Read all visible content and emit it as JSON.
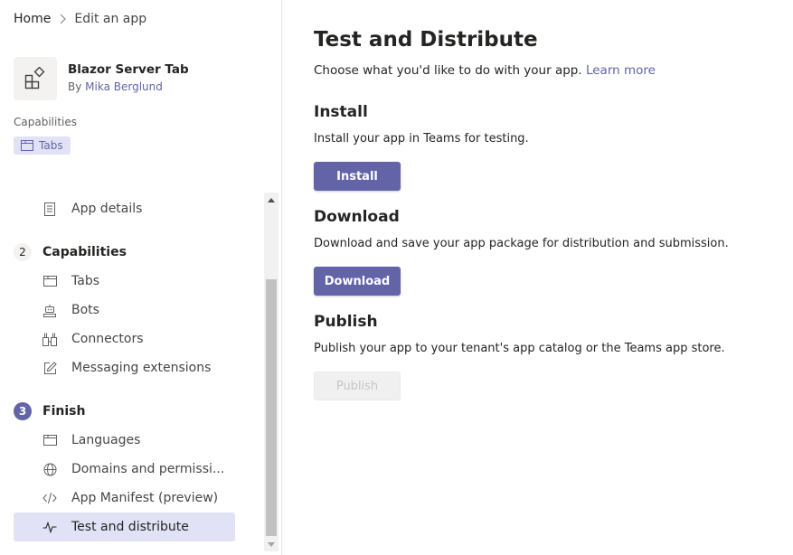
{
  "breadcrumb": {
    "home": "Home",
    "current": "Edit an app"
  },
  "app": {
    "name": "Blazor Server Tab",
    "by_prefix": "By",
    "author": "Mika Berglund"
  },
  "capabilities_summary": {
    "heading": "Capabilities",
    "chip": "Tabs"
  },
  "nav": {
    "app_details": "App details",
    "capabilities": {
      "number": "2",
      "label": "Capabilities"
    },
    "tabs": "Tabs",
    "bots": "Bots",
    "connectors": "Connectors",
    "messaging": "Messaging extensions",
    "finish": {
      "number": "3",
      "label": "Finish"
    },
    "languages": "Languages",
    "domains": "Domains and permissi...",
    "manifest": "App Manifest (preview)",
    "test": "Test and distribute"
  },
  "main": {
    "title": "Test and Distribute",
    "subtitle": "Choose what you'd like to do with your app.",
    "learn_more": "Learn more",
    "install": {
      "title": "Install",
      "text": "Install your app in Teams for testing.",
      "button": "Install"
    },
    "download": {
      "title": "Download",
      "text": "Download and save your app package for distribution and submission.",
      "button": "Download"
    },
    "publish": {
      "title": "Publish",
      "text": "Publish your app to your tenant's app catalog or the Teams app store.",
      "button": "Publish"
    }
  },
  "colors": {
    "accent": "#6264a7",
    "active_bg": "#e2e2f6"
  }
}
